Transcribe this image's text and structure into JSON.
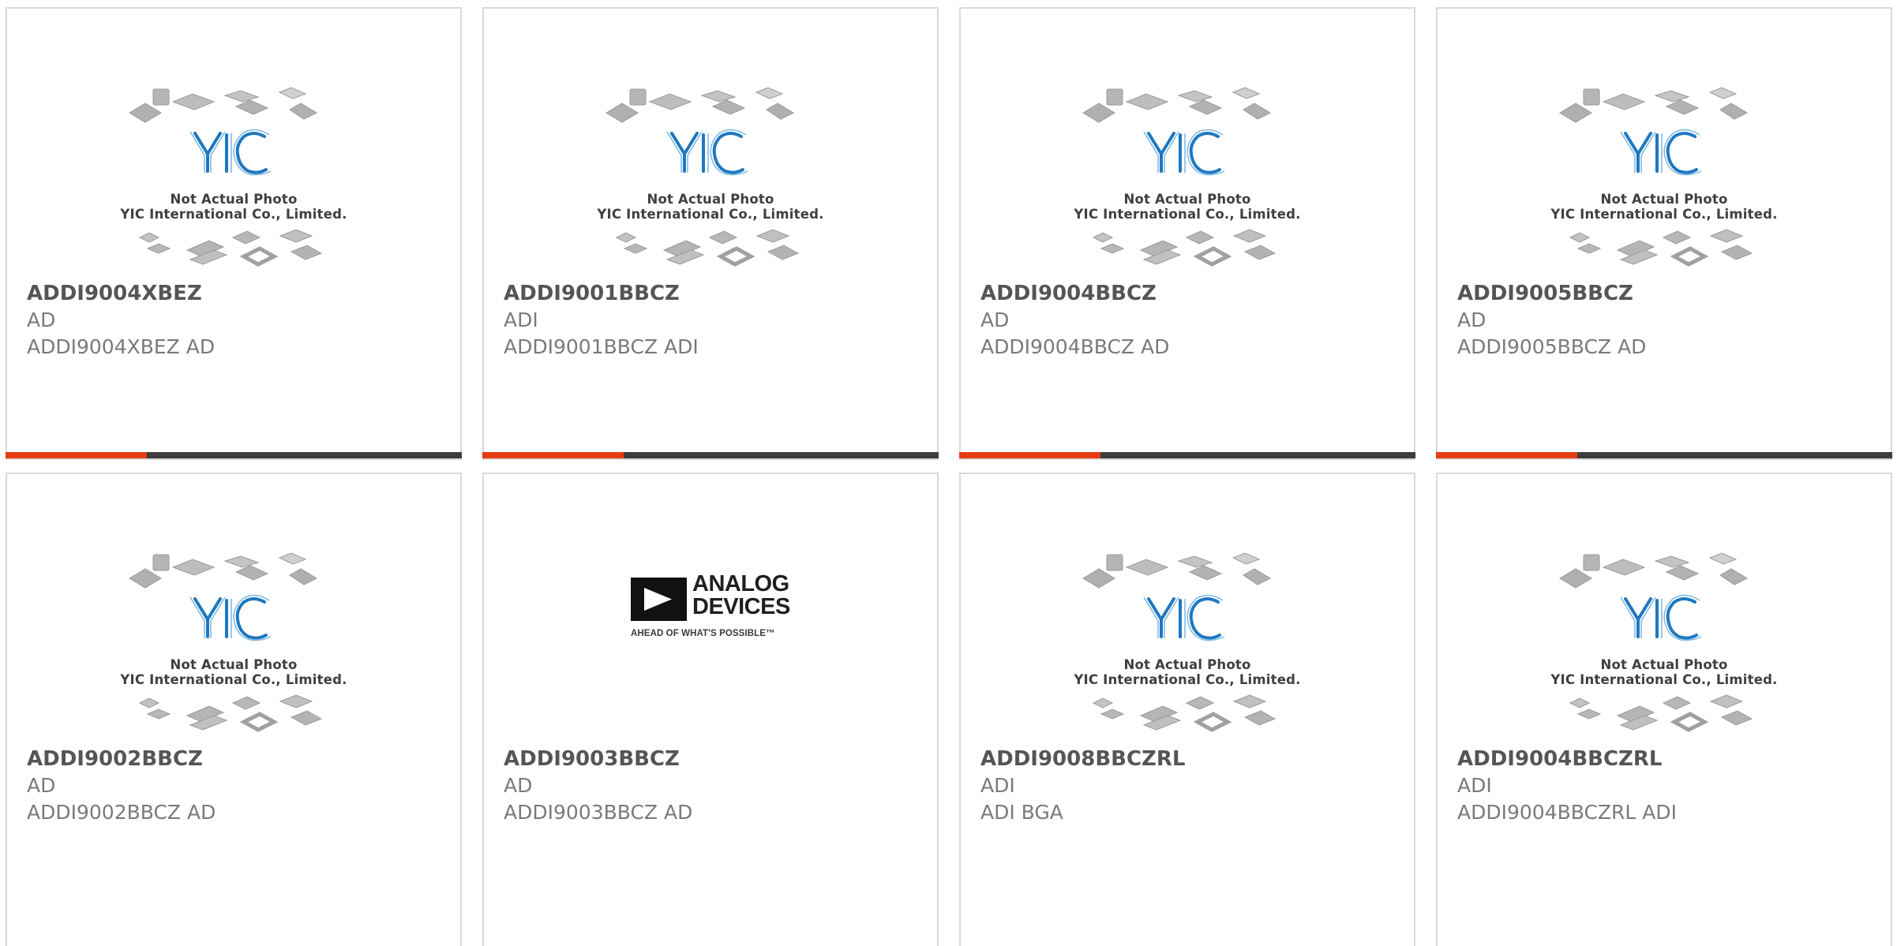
{
  "colors": {
    "accent": "#e63c12",
    "bar": "#3d3d3d",
    "border": "#d9d9d9",
    "text_title": "#555555",
    "text_muted": "#7a7a7a"
  },
  "placeholder": {
    "line1": "Not Actual Photo",
    "line2": "YIC International Co., Limited."
  },
  "analog_logo": {
    "name_line1": "ANALOG",
    "name_line2": "DEVICES",
    "tagline": "AHEAD OF WHAT'S POSSIBLE™"
  },
  "products": [
    {
      "part": "ADDI9004XBEZ",
      "brand": "AD",
      "desc": "ADDI9004XBEZ AD",
      "image": "yic-placeholder",
      "progress": 0.31
    },
    {
      "part": "ADDI9001BBCZ",
      "brand": "ADI",
      "desc": "ADDI9001BBCZ ADI",
      "image": "yic-placeholder",
      "progress": 0.31
    },
    {
      "part": "ADDI9004BBCZ",
      "brand": "AD",
      "desc": "ADDI9004BBCZ AD",
      "image": "yic-placeholder",
      "progress": 0.31
    },
    {
      "part": "ADDI9005BBCZ",
      "brand": "AD",
      "desc": "ADDI9005BBCZ AD",
      "image": "yic-placeholder",
      "progress": 0.31
    },
    {
      "part": "ADDI9002BBCZ",
      "brand": "AD",
      "desc": "ADDI9002BBCZ AD",
      "image": "yic-placeholder"
    },
    {
      "part": "ADDI9003BBCZ",
      "brand": "AD",
      "desc": "ADDI9003BBCZ AD",
      "image": "analog-devices-logo"
    },
    {
      "part": "ADDI9008BBCZRL",
      "brand": "ADI",
      "desc": "ADI BGA",
      "image": "yic-placeholder"
    },
    {
      "part": "ADDI9004BBCZRL",
      "brand": "ADI",
      "desc": "ADDI9004BBCZRL ADI",
      "image": "yic-placeholder"
    }
  ]
}
